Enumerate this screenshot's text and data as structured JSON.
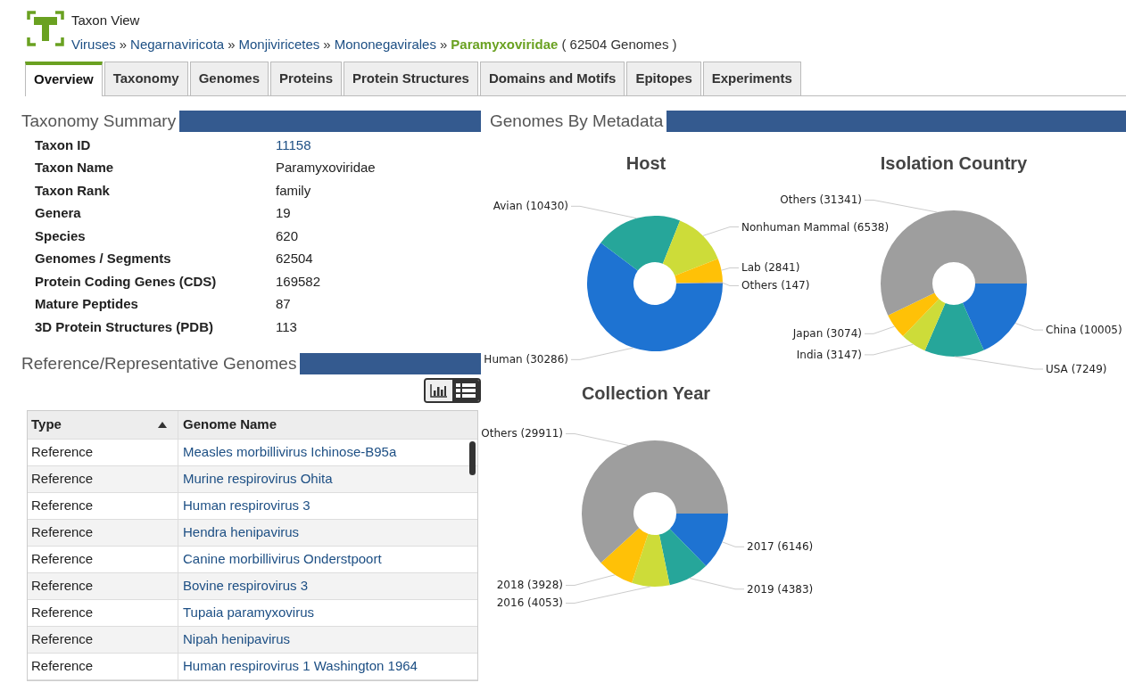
{
  "header": {
    "title": "Taxon View",
    "breadcrumb": [
      {
        "label": "Viruses"
      },
      {
        "label": "Negarnaviricota"
      },
      {
        "label": "Monjiviricetes"
      },
      {
        "label": "Mononegavirales"
      }
    ],
    "separator": "»",
    "current": "Paramyxoviridae",
    "genome_count": "( 62504 Genomes )"
  },
  "tabs": [
    {
      "label": "Overview",
      "selected": true
    },
    {
      "label": "Taxonomy",
      "selected": false
    },
    {
      "label": "Genomes",
      "selected": false
    },
    {
      "label": "Proteins",
      "selected": false
    },
    {
      "label": "Protein Structures",
      "selected": false
    },
    {
      "label": "Domains and Motifs",
      "selected": false
    },
    {
      "label": "Epitopes",
      "selected": false
    },
    {
      "label": "Experiments",
      "selected": false
    }
  ],
  "taxonomy_summary": {
    "title": "Taxonomy Summary",
    "rows": [
      {
        "label": "Taxon ID",
        "value": "11158",
        "kind": "link"
      },
      {
        "label": "Taxon Name",
        "value": "Paramyxoviridae",
        "kind": "text"
      },
      {
        "label": "Taxon Rank",
        "value": "family",
        "kind": "text"
      },
      {
        "label": "Genera",
        "value": "19",
        "kind": "text"
      },
      {
        "label": "Species",
        "value": "620",
        "kind": "text"
      },
      {
        "label": "Genomes / Segments",
        "value": "62504",
        "kind": "text"
      },
      {
        "label": "Protein Coding Genes (CDS)",
        "value": "169582",
        "kind": "text"
      },
      {
        "label": "Mature Peptides",
        "value": "87",
        "kind": "text"
      },
      {
        "label": "3D Protein Structures (PDB)",
        "value": "113",
        "kind": "text"
      }
    ]
  },
  "reference_genomes": {
    "title": "Reference/Representative Genomes",
    "view_toggle": [
      {
        "kind": "chart",
        "selected": false
      },
      {
        "kind": "list",
        "selected": true
      }
    ],
    "columns": [
      {
        "label": "Type",
        "sorted_ascending": true
      },
      {
        "label": "Genome Name"
      }
    ],
    "rows": [
      {
        "type": "Reference",
        "name": "Measles morbillivirus Ichinose-B95a"
      },
      {
        "type": "Reference",
        "name": "Murine respirovirus Ohita"
      },
      {
        "type": "Reference",
        "name": "Human respirovirus 3"
      },
      {
        "type": "Reference",
        "name": "Hendra henipavirus"
      },
      {
        "type": "Reference",
        "name": "Canine morbillivirus Onderstpoort"
      },
      {
        "type": "Reference",
        "name": "Bovine respirovirus 3"
      },
      {
        "type": "Reference",
        "name": "Tupaia paramyxovirus"
      },
      {
        "type": "Reference",
        "name": "Nipah henipavirus"
      },
      {
        "type": "Reference",
        "name": "Human respirovirus 1 Washington 1964"
      }
    ]
  },
  "genomes_by_metadata": {
    "title": "Genomes By Metadata",
    "charts": [
      {
        "chart_data": {
          "type": "donut",
          "title": "Host",
          "categories": [
            "Human (30286)",
            "Avian (10430)",
            "Nonhuman Mammal (6538)",
            "Lab (2841)",
            "Others (147)"
          ],
          "values": [
            30286,
            10430,
            6538,
            2841,
            147
          ]
        }
      },
      {
        "chart_data": {
          "type": "donut",
          "title": "Isolation Country",
          "categories": [
            "China (10005)",
            "USA (7249)",
            "India (3147)",
            "Japan (3074)",
            "Others (31341)"
          ],
          "values": [
            10005,
            7249,
            3147,
            3074,
            31341
          ]
        }
      },
      {
        "chart_data": {
          "type": "donut",
          "title": "Collection Year",
          "categories": [
            "2017 (6146)",
            "2019 (4383)",
            "2016 (4053)",
            "2018 (3928)",
            "Others (29911)"
          ],
          "values": [
            6146,
            4383,
            4053,
            3928,
            29911
          ]
        }
      }
    ]
  }
}
